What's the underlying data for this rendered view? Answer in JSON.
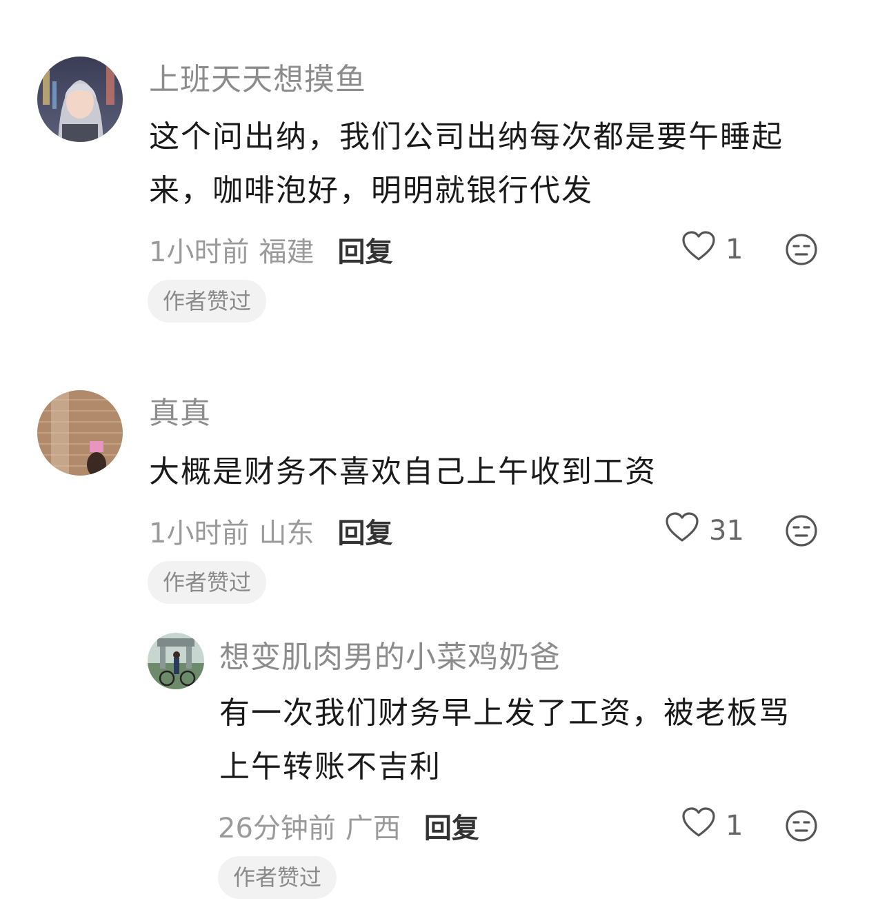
{
  "comments": [
    {
      "username": "上班天天想摸鱼",
      "content_line1": "这个问出纳，我们公司出纳每次都是要午睡起",
      "content_line2": "来，咖啡泡好，明明就银行代发",
      "time": "1小时前",
      "location": "福建",
      "reply_label": "回复",
      "likes": "1",
      "badge": "作者赞过",
      "icons": {
        "like": "heart-outline-icon",
        "dislike": "meh-face-icon"
      }
    },
    {
      "username": "真真",
      "content_line1": "大概是财务不喜欢自己上午收到工资",
      "time": "1小时前",
      "location": "山东",
      "reply_label": "回复",
      "likes": "31",
      "badge": "作者赞过",
      "icons": {
        "like": "heart-outline-icon",
        "dislike": "meh-face-icon"
      }
    },
    {
      "username": "想变肌肉男的小菜鸡奶爸",
      "content_line1": "有一次我们财务早上发了工资，被老板骂",
      "content_line2": "上午转账不吉利",
      "time": "26分钟前",
      "location": "广西",
      "reply_label": "回复",
      "likes": "1",
      "badge": "作者赞过",
      "icons": {
        "like": "heart-outline-icon",
        "dislike": "meh-face-icon"
      }
    }
  ],
  "colors": {
    "username": "#8c8c8c",
    "meta": "#9a9a9a",
    "badge_bg": "#f2f2f2"
  }
}
